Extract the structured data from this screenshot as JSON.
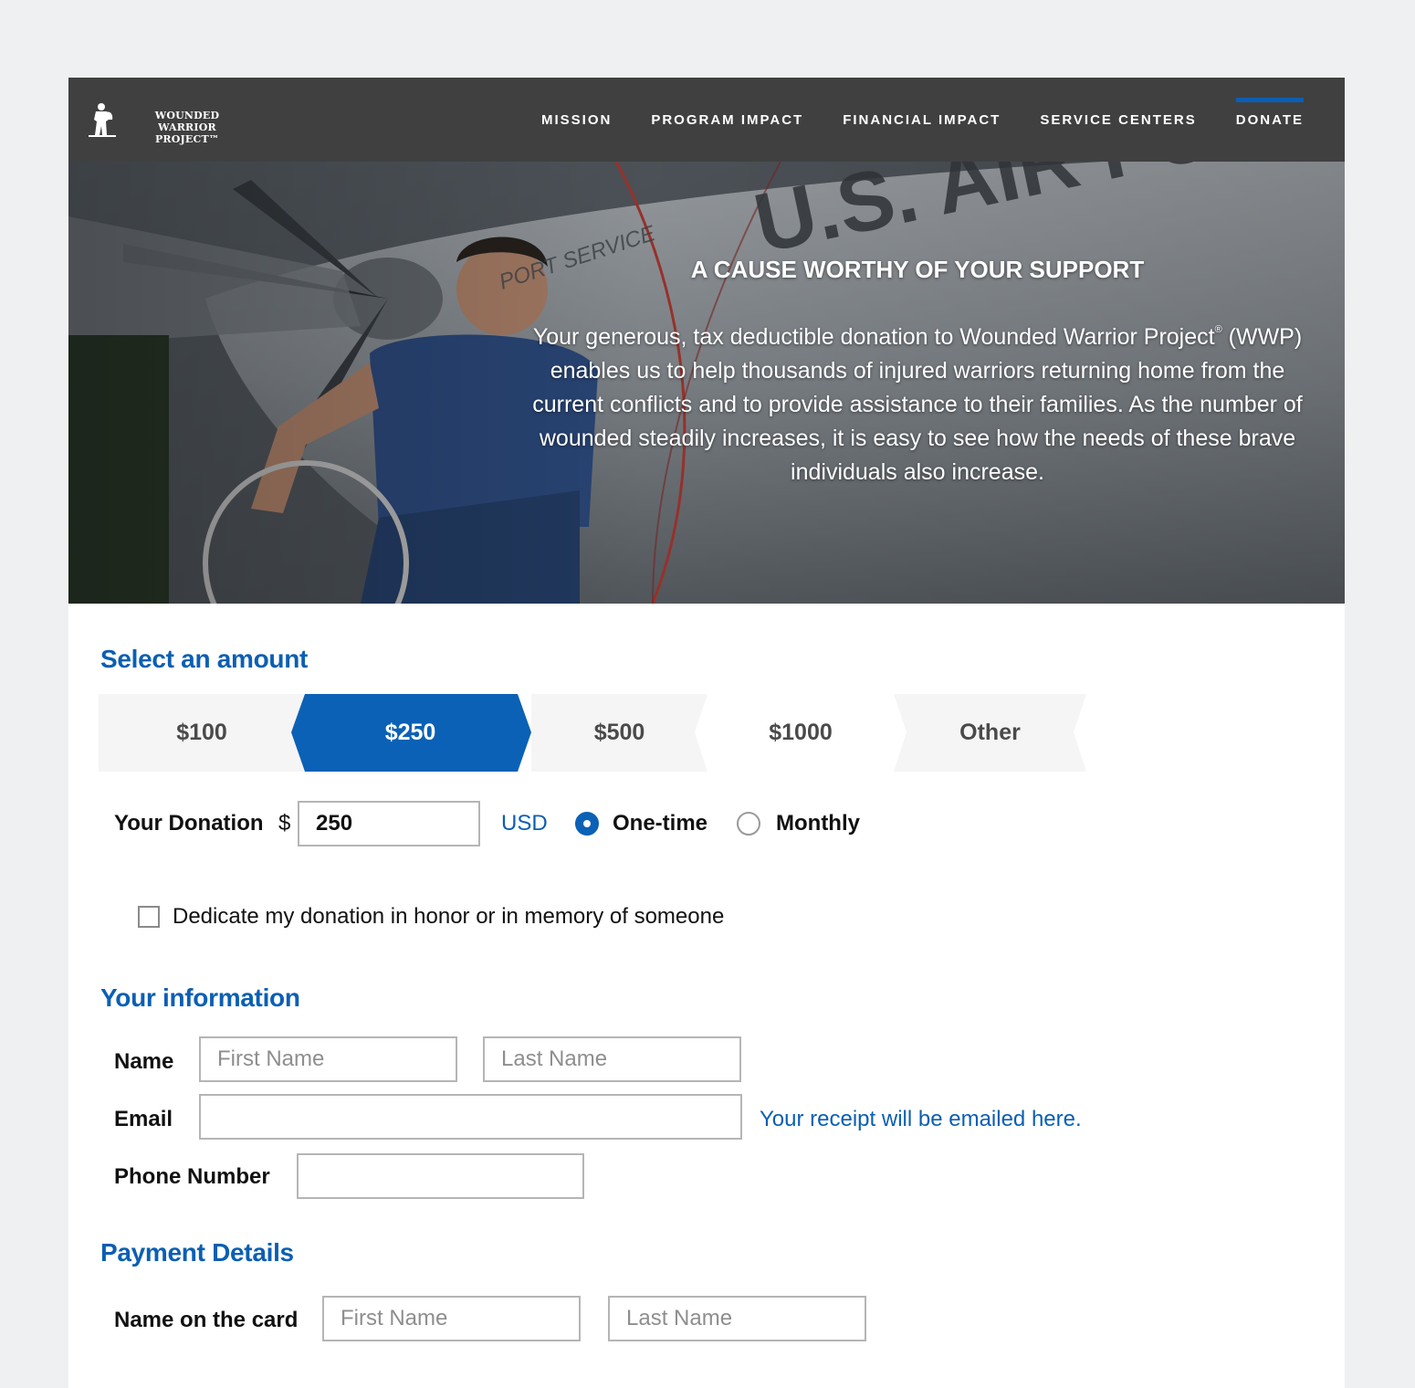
{
  "brand": {
    "logo_line1": "WOUNDED WARRIOR",
    "logo_line2": "PROJECT™"
  },
  "nav": {
    "items": [
      "MISSION",
      "PROGRAM IMPACT",
      "FINANCIAL IMPACT",
      "SERVICE CENTERS",
      "DONATE"
    ],
    "active": "DONATE",
    "accent_color": "#0b5fb3"
  },
  "hero": {
    "title": "A CAUSE WORTHY OF YOUR SUPPORT",
    "body_part1": "Your generous, tax deductible donation to Wounded Warrior Project",
    "body_reg": "®",
    "body_part2": " (WWP) enables us to help thousands of injured warriors returning home from the current conflicts and to provide assistance to their families. As the number of wounded steadily increases, it is easy to see how the needs of these brave individuals also increase.",
    "plane_text": "U.S. AIR FORC",
    "plane_subtext": "PORT SERVICE"
  },
  "amount_section": {
    "title": "Select an amount",
    "options": [
      "$100",
      "$250",
      "$500",
      "$1000",
      "Other"
    ],
    "selected": "$250"
  },
  "donation": {
    "label": "Your Donation",
    "currency_symbol": "$",
    "value": "250",
    "currency": "USD",
    "frequency_options": [
      "One-time",
      "Monthly"
    ],
    "frequency_selected": "One-time"
  },
  "dedicate": {
    "label": "Dedicate my donation in honor or in memory of someone",
    "checked": false
  },
  "info_section": {
    "title": "Your information",
    "name_label": "Name",
    "first_placeholder": "First Name",
    "last_placeholder": "Last Name",
    "email_label": "Email",
    "email_value": "",
    "email_note": "Your receipt will be emailed here.",
    "phone_label": "Phone Number",
    "phone_value": ""
  },
  "payment_section": {
    "title": "Payment Details",
    "card_name_label": "Name on the card",
    "first_placeholder": "First Name",
    "last_placeholder": "Last Name"
  },
  "colors": {
    "primary_blue": "#0b61b5",
    "header_bg": "#404040",
    "page_bg": "#eff0f2"
  }
}
